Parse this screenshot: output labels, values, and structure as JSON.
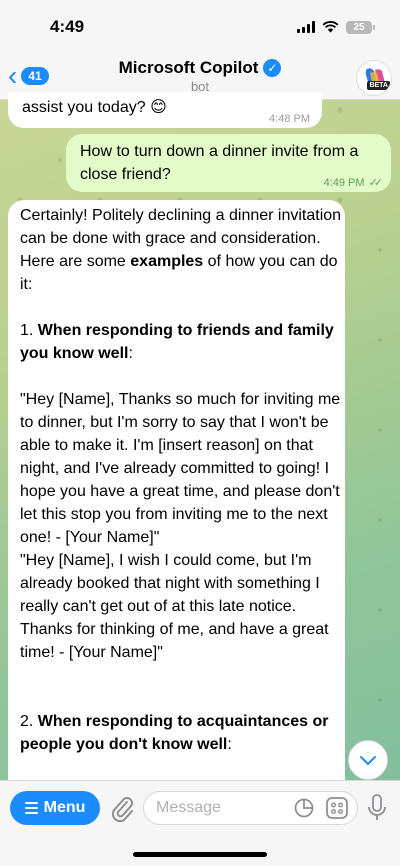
{
  "status_bar": {
    "time": "4:49",
    "battery": "25"
  },
  "header": {
    "back_count": "41",
    "title": "Microsoft Copilot",
    "subtitle": "bot",
    "avatar_badge": "BETA"
  },
  "messages": [
    {
      "sender": "bot",
      "text": "assist you today? 😊",
      "time": "4:48 PM"
    },
    {
      "sender": "user",
      "text": "How to turn down a dinner invite from a close friend?",
      "time": "4:49 PM",
      "status": "read"
    },
    {
      "sender": "bot",
      "intro_a": "Certainly! Politely declining a dinner invitation can be done with grace and consideration. Here are some ",
      "intro_bold": "examples",
      "intro_b": " of how you can do it:",
      "section1_num": "1. ",
      "section1_bold": "When responding to friends and family you know well",
      "section1_tail": ":",
      "example1": "\"Hey [Name], Thanks so much for inviting me to dinner, but I'm sorry to say that I won't be able to make it. I'm [insert reason] on that night, and I've already committed to going! I hope you have a great time, and please don't let this stop you from inviting me to the next one! - [Your Name]\"",
      "example2": "\"Hey [Name], I wish I could come, but I'm already booked that night with something I really can't get out of at this late notice. Thanks for thinking of me, and have a great time! - [Your Name]\"",
      "section2_num": "2. ",
      "section2_bold": "When responding to acquaintances or people you don't know well",
      "section2_tail": ":"
    }
  ],
  "input_bar": {
    "menu_label": "Menu",
    "placeholder": "Message"
  },
  "icons": {
    "back": "chevron-left-icon",
    "verified": "verified-check-icon",
    "attach": "paperclip-icon",
    "sticker": "sticker-icon",
    "commands": "bot-commands-icon",
    "mic": "microphone-icon",
    "scroll": "chevron-down-icon"
  },
  "colors": {
    "accent": "#1a8cff",
    "outgoing_bubble": "#e2fbc9",
    "incoming_bubble": "#ffffff",
    "read_ticks": "#5aa15a"
  }
}
